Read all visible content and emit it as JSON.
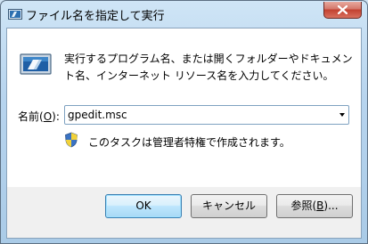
{
  "window": {
    "title": "ファイル名を指定して実行"
  },
  "dialog": {
    "description": "実行するプログラム名、または開くフォルダーやドキュメント名、インターネット リソース名を入力してください。",
    "open_label_prefix": "名前(",
    "open_label_accel": "O",
    "open_label_suffix": "):",
    "open_value": "gpedit.msc",
    "admin_notice": "このタスクは管理者特権で作成されます。"
  },
  "buttons": {
    "ok_label": "OK",
    "cancel_label": "キャンセル",
    "browse_prefix": "参照(",
    "browse_accel": "B",
    "browse_suffix": ")..."
  },
  "icons": {
    "title": "run-icon",
    "close": "close-icon",
    "main": "run-icon",
    "uac": "uac-shield-icon",
    "combo_arrow": "dropdown-arrow-icon"
  },
  "colors": {
    "accent": "#3c7fb1",
    "close_button": "#c2402f"
  }
}
